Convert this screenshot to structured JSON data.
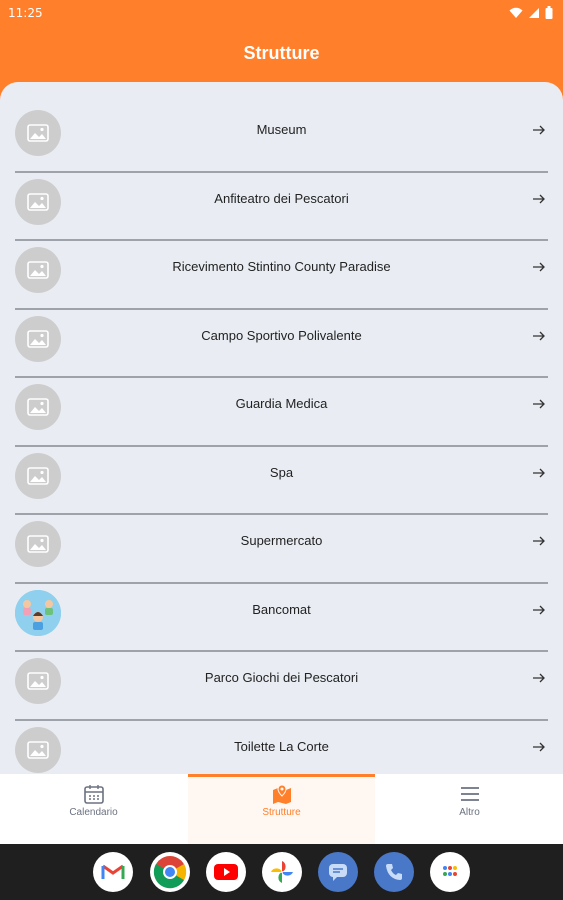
{
  "status_bar": {
    "time": "11:25"
  },
  "header": {
    "title": "Strutture"
  },
  "list": {
    "items": [
      {
        "label": "Museum",
        "avatar": "image-placeholder-icon"
      },
      {
        "label": "Anfiteatro dei Pescatori",
        "avatar": "image-placeholder-icon"
      },
      {
        "label": "Ricevimento Stintino County Paradise",
        "avatar": "image-placeholder-icon"
      },
      {
        "label": "Campo Sportivo Polivalente",
        "avatar": "image-placeholder-icon"
      },
      {
        "label": "Guardia Medica",
        "avatar": "image-placeholder-icon"
      },
      {
        "label": "Spa",
        "avatar": "image-placeholder-icon"
      },
      {
        "label": "Supermercato",
        "avatar": "image-placeholder-icon"
      },
      {
        "label": "Bancomat",
        "avatar": "people-photo"
      },
      {
        "label": "Parco Giochi dei Pescatori",
        "avatar": "image-placeholder-icon"
      },
      {
        "label": "Toilette La Corte",
        "avatar": "image-placeholder-icon"
      }
    ]
  },
  "bottom_nav": {
    "tabs": [
      {
        "label": "Calendario",
        "icon": "calendar-icon",
        "active": false
      },
      {
        "label": "Strutture",
        "icon": "map-pin-icon",
        "active": true
      },
      {
        "label": "Altro",
        "icon": "menu-icon",
        "active": false
      }
    ]
  },
  "dock": [
    "gmail-icon",
    "chrome-icon",
    "youtube-icon",
    "photos-icon",
    "messages-icon",
    "phone-icon",
    "apps-icon"
  ],
  "colors": {
    "accent": "#ff7f2a",
    "list_bg": "#e9edf3",
    "divider": "#9ea3ab"
  }
}
